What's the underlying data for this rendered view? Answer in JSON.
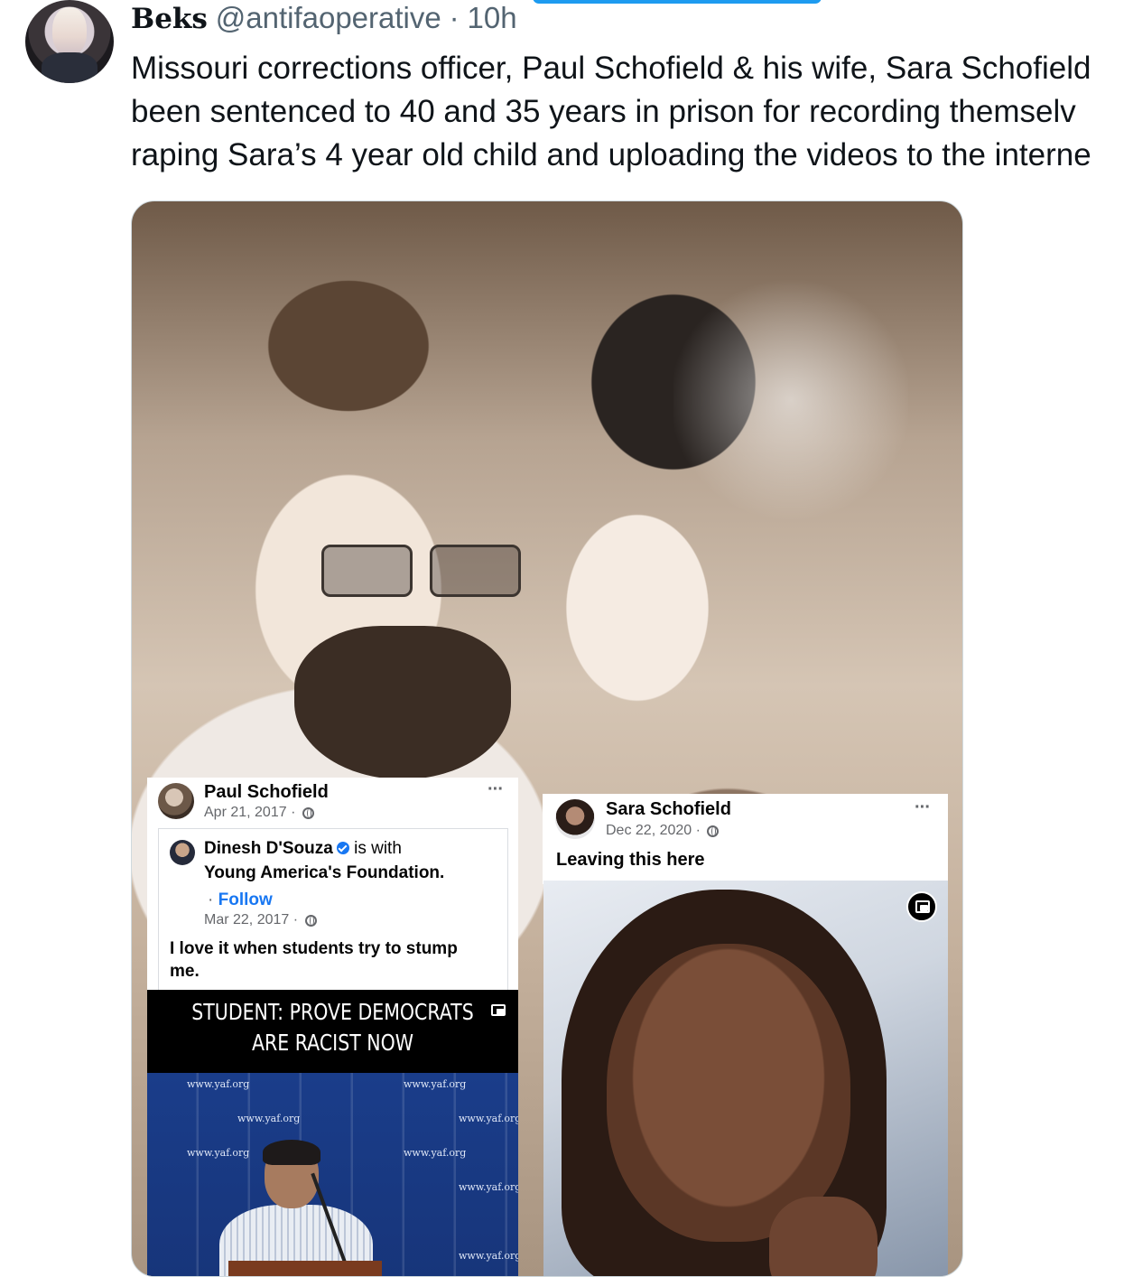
{
  "tweet": {
    "display_name": "Beks",
    "handle": "@antifaoperative",
    "separator": "·",
    "time": "10h",
    "text_lines": [
      "Missouri corrections officer, Paul Schofield & his wife, Sara Schofield",
      "been sentenced to 40 and 35 years in prison for recording themselv",
      "raping Sara’s 4 year old child and uploading the videos to the interne"
    ]
  },
  "paul_post": {
    "author": "Paul Schofield",
    "meta": "Apr 21, 2017 ·",
    "more": "···",
    "shared": {
      "author": "Dinesh D'Souza",
      "with_text": "is with",
      "org": "Young America's Foundation.",
      "follow_prefix": "·",
      "follow": "Follow",
      "date": "Mar 22, 2017 ·",
      "text_line1": "I love it when students try to stump",
      "text_line2": "me."
    },
    "video": {
      "title_line1": "STUDENT: PROVE DEMOCRATS",
      "title_line2": "ARE RACIST NOW",
      "backdrop_text": "www.yaf.org"
    }
  },
  "sara_post": {
    "author": "Sara Schofield",
    "meta": "Dec 22, 2020 ·",
    "more": "···",
    "caption": "Leaving this here"
  },
  "colors": {
    "text_primary": "#0f1419",
    "text_secondary": "#536471",
    "fb_link": "#1877f2",
    "accent_pill": "#1d9bf0"
  },
  "icons": [
    "globe-icon",
    "verified-icon",
    "more-icon",
    "pip-icon"
  ]
}
